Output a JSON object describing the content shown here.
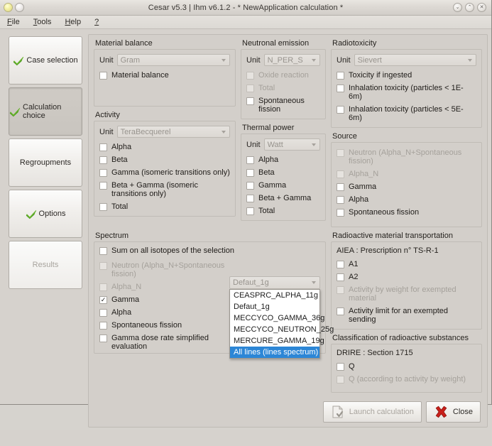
{
  "window": {
    "title": "Cesar v5.3 | Ihm v6.1.2 - * NewApplication calculation *",
    "controls": {
      "minimize": "⌄",
      "maximize": "⌃",
      "close": "✕"
    }
  },
  "menubar": {
    "items": [
      {
        "pre": "F",
        "rest": "ile"
      },
      {
        "pre": "T",
        "rest": "ools"
      },
      {
        "pre": "H",
        "rest": "elp"
      },
      {
        "pre": "?",
        "rest": ""
      }
    ]
  },
  "sidebar": {
    "items": [
      {
        "label": "Case selection",
        "checked": true,
        "state": "normal"
      },
      {
        "label": "Calculation choice",
        "checked": true,
        "state": "pressed"
      },
      {
        "label": "Regroupments",
        "checked": false,
        "state": "normal"
      },
      {
        "label": "Options",
        "checked": true,
        "state": "normal"
      },
      {
        "label": "Results",
        "checked": false,
        "state": "disabled"
      }
    ]
  },
  "groups": {
    "material_balance": {
      "title": "Material balance",
      "unit_label": "Unit",
      "unit_value": "Gram",
      "checkboxes": [
        {
          "label": "Material balance",
          "checked": false,
          "disabled": false
        }
      ]
    },
    "neutronal_emission": {
      "title": "Neutronal emission",
      "unit_label": "Unit",
      "unit_value": "N_PER_S",
      "checkboxes": [
        {
          "label": "Oxide reaction",
          "checked": false,
          "disabled": true
        },
        {
          "label": "Total",
          "checked": false,
          "disabled": true
        },
        {
          "label": "Spontaneous fission",
          "checked": false,
          "disabled": false
        }
      ]
    },
    "radiotoxicity": {
      "title": "Radiotoxicity",
      "unit_label": "Unit",
      "unit_value": "Sievert",
      "checkboxes": [
        {
          "label": "Toxicity if ingested",
          "checked": false,
          "disabled": false
        },
        {
          "label": "Inhalation toxicity (particles < 1E-6m)",
          "checked": false,
          "disabled": false
        },
        {
          "label": "Inhalation toxicity (particles < 5E-6m)",
          "checked": false,
          "disabled": false
        }
      ]
    },
    "activity": {
      "title": "Activity",
      "unit_label": "Unit",
      "unit_value": "TeraBecquerel",
      "checkboxes": [
        {
          "label": "Alpha",
          "checked": false,
          "disabled": false
        },
        {
          "label": "Beta",
          "checked": false,
          "disabled": false
        },
        {
          "label": "Gamma (isomeric transitions only)",
          "checked": false,
          "disabled": false
        },
        {
          "label": "Beta + Gamma (isomeric transitions only)",
          "checked": false,
          "disabled": false
        },
        {
          "label": "Total",
          "checked": false,
          "disabled": false
        }
      ]
    },
    "thermal_power": {
      "title": "Thermal power",
      "unit_label": "Unit",
      "unit_value": "Watt",
      "checkboxes": [
        {
          "label": "Alpha",
          "checked": false,
          "disabled": false
        },
        {
          "label": "Beta",
          "checked": false,
          "disabled": false
        },
        {
          "label": "Gamma",
          "checked": false,
          "disabled": false
        },
        {
          "label": "Beta + Gamma",
          "checked": false,
          "disabled": false
        },
        {
          "label": "Total",
          "checked": false,
          "disabled": false
        }
      ]
    },
    "source": {
      "title": "Source",
      "checkboxes": [
        {
          "label": "Neutron (Alpha_N+Spontaneous fission)",
          "checked": false,
          "disabled": true
        },
        {
          "label": "Alpha_N",
          "checked": false,
          "disabled": true
        },
        {
          "label": "Gamma",
          "checked": false,
          "disabled": false
        },
        {
          "label": "Alpha",
          "checked": false,
          "disabled": false
        },
        {
          "label": "Spontaneous fission",
          "checked": false,
          "disabled": false
        }
      ]
    },
    "spectrum": {
      "title": "Spectrum",
      "sum_label": "Sum on all isotopes of the selection",
      "sum_checked": false,
      "checkboxes": [
        {
          "label": "Neutron (Alpha_N+Spontaneous fission)",
          "checked": false,
          "disabled": true
        },
        {
          "label": "Alpha_N",
          "checked": false,
          "disabled": true
        },
        {
          "label": "Gamma",
          "checked": true,
          "disabled": false
        },
        {
          "label": "Alpha",
          "checked": false,
          "disabled": false
        },
        {
          "label": "Spontaneous fission",
          "checked": false,
          "disabled": false
        },
        {
          "label": "Gamma dose rate simplified evaluation",
          "checked": false,
          "disabled": false
        }
      ],
      "combo_value": "Defaut_1g",
      "dropdown_open": true,
      "dropdown_options": [
        {
          "label": "CEASPRC_ALPHA_11g",
          "selected": false
        },
        {
          "label": "Defaut_1g",
          "selected": false
        },
        {
          "label": "MECCYCO_GAMMA_36g",
          "selected": false
        },
        {
          "label": "MECCYCO_NEUTRON_25g",
          "selected": false
        },
        {
          "label": "MERCURE_GAMMA_19g",
          "selected": false
        },
        {
          "label": "All lines (lines spectrum)",
          "selected": true
        }
      ]
    },
    "transportation": {
      "title": "Radioactive material transportation",
      "note": "AIEA : Prescription n° TS-R-1",
      "checkboxes": [
        {
          "label": "A1",
          "checked": false,
          "disabled": false
        },
        {
          "label": "A2",
          "checked": false,
          "disabled": false
        },
        {
          "label": "Activity by weight for exempted material",
          "checked": false,
          "disabled": true
        },
        {
          "label": "Activity limit for an exempted sending",
          "checked": false,
          "disabled": false
        }
      ]
    },
    "classification": {
      "title": "Classification of radioactive substances",
      "note": "DRIRE : Section 1715",
      "checkboxes": [
        {
          "label": "Q",
          "checked": false,
          "disabled": false
        },
        {
          "label": "Q (according to activity by weight)",
          "checked": false,
          "disabled": true
        }
      ]
    }
  },
  "footer": {
    "launch_label": "Launch calculation",
    "launch_disabled": true,
    "close_label": "Close"
  },
  "colors": {
    "selection_blue": "#2c86d6",
    "check_green": "#5aa22a",
    "close_red": "#c02018",
    "window_bg": "#d6d2cd",
    "panel_bg": "#d3cfca"
  }
}
